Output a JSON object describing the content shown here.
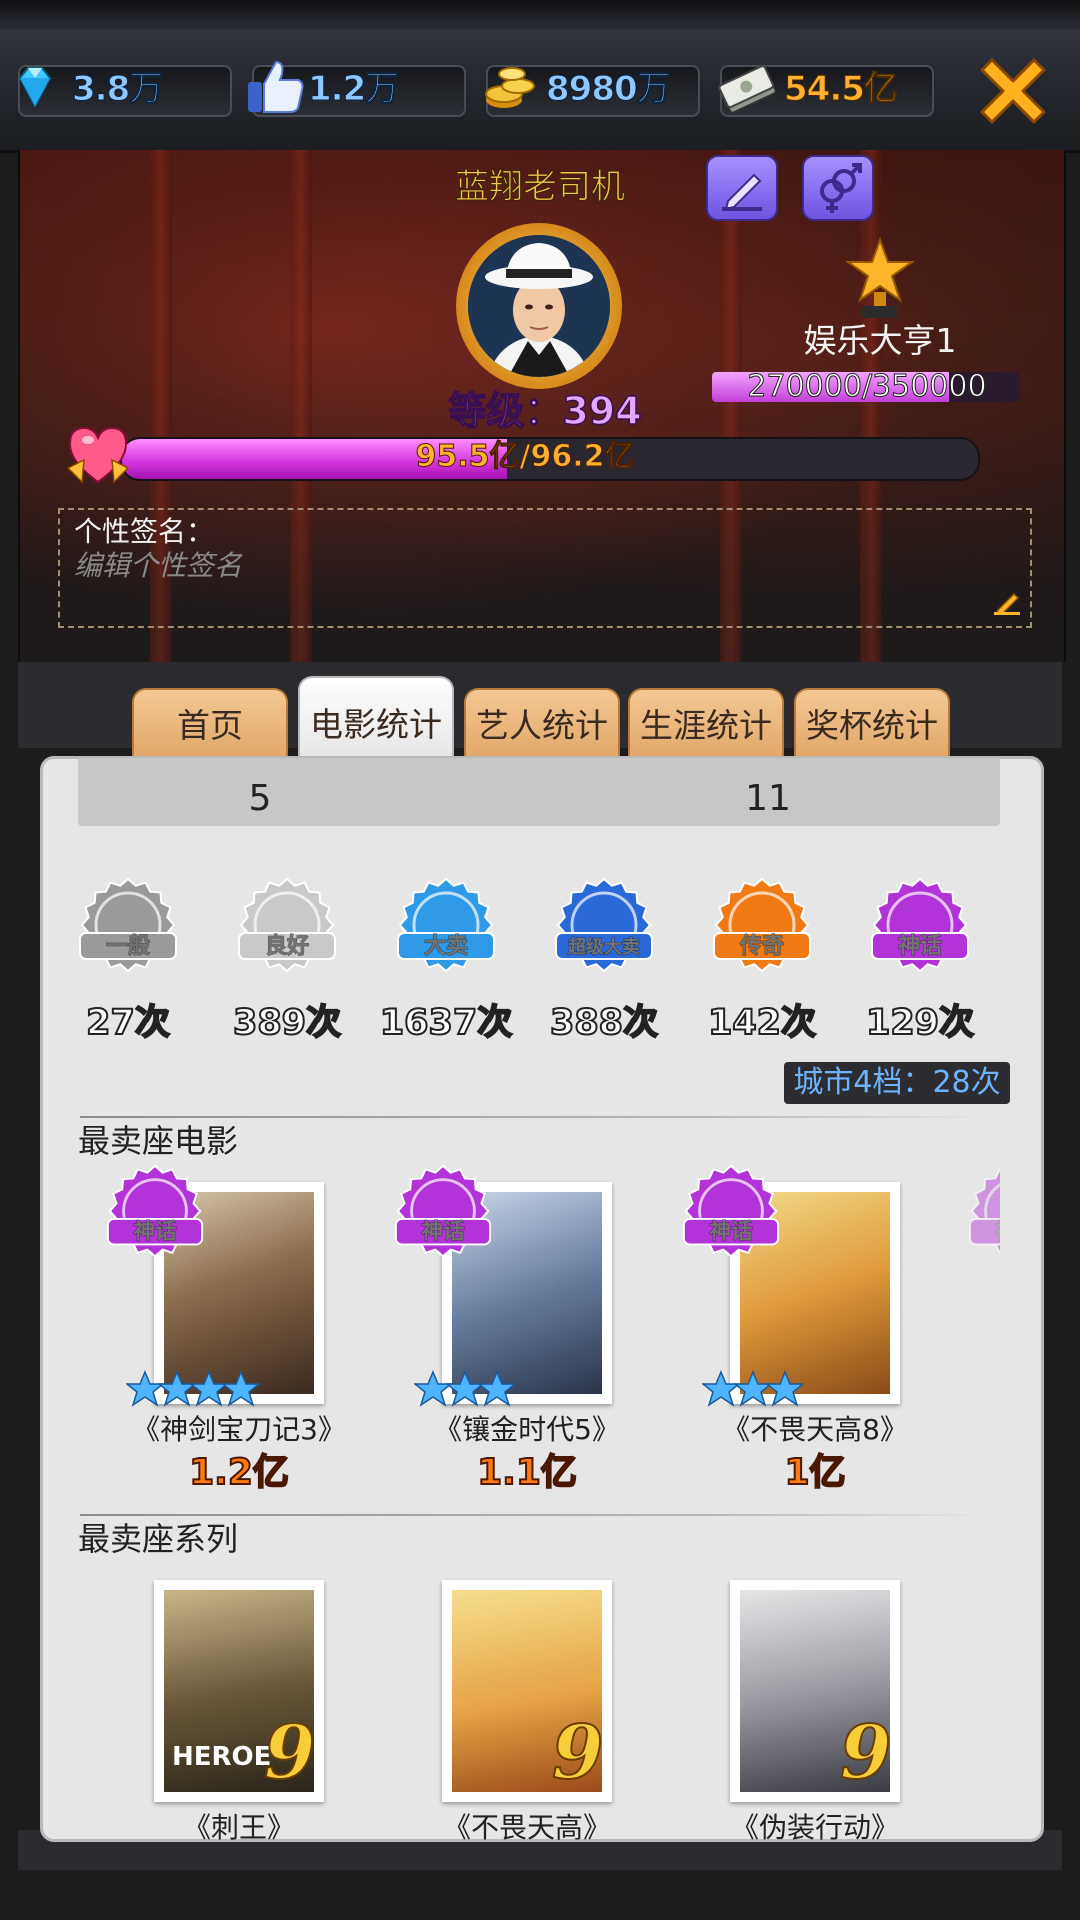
{
  "currencies": [
    {
      "icon": "diamond-icon",
      "value": "3.8万"
    },
    {
      "icon": "thumbs-up-icon",
      "value": "1.2万"
    },
    {
      "icon": "gold-coins-icon",
      "value": "8980万"
    },
    {
      "icon": "cash-icon",
      "value": "54.5亿"
    }
  ],
  "profile": {
    "name": "蓝翔老司机",
    "level_text": "等级：394",
    "title": "娱乐大亨1",
    "title_progress": "270000/350000",
    "title_progress_fraction": 0.77,
    "box_office_progress": "95.5亿/96.2亿",
    "box_office_fraction": 0.45,
    "signature_label": "个性签名：",
    "signature_placeholder": "编辑个性签名"
  },
  "tabs": [
    {
      "label": "首页",
      "active": false
    },
    {
      "label": "电影统计",
      "active": true
    },
    {
      "label": "艺人统计",
      "active": false
    },
    {
      "label": "生涯统计",
      "active": false
    },
    {
      "label": "奖杯统计",
      "active": false
    }
  ],
  "stats": {
    "cut_values": [
      "5",
      "11"
    ],
    "ratings": [
      {
        "badge": "一般",
        "count": "27次",
        "color": "#9a9a9a"
      },
      {
        "badge": "良好",
        "count": "389次",
        "color": "#c9c9c9"
      },
      {
        "badge": "大卖",
        "count": "1637次",
        "color": "#2f9ae8"
      },
      {
        "badge": "超级大卖",
        "count": "388次",
        "color": "#2a6ad8"
      },
      {
        "badge": "传奇",
        "count": "142次",
        "color": "#f07a14"
      },
      {
        "badge": "神话",
        "count": "129次",
        "color": "#b233d8"
      }
    ],
    "city_tier": "城市4档：28次"
  },
  "best_movies": {
    "title": "最卖座电影",
    "items": [
      {
        "name": "《神剑宝刀记3》",
        "gross": "1.2亿",
        "badge": "神话",
        "stars": 4
      },
      {
        "name": "《镶金时代5》",
        "gross": "1.1亿",
        "badge": "神话",
        "stars": 3
      },
      {
        "name": "《不畏天高8》",
        "gross": "1亿",
        "badge": "神话",
        "stars": 3
      }
    ]
  },
  "best_series": {
    "title": "最卖座系列",
    "items": [
      {
        "name": "《刺王》",
        "count": "9",
        "poster_text": "HEROE"
      },
      {
        "name": "《不畏天高》",
        "count": "9"
      },
      {
        "name": "《伪装行动》",
        "count": "9"
      }
    ]
  },
  "colors": {
    "accent_gold": "#ffb030",
    "accent_purple": "#c23fd8",
    "mythic": "#b233d8"
  }
}
